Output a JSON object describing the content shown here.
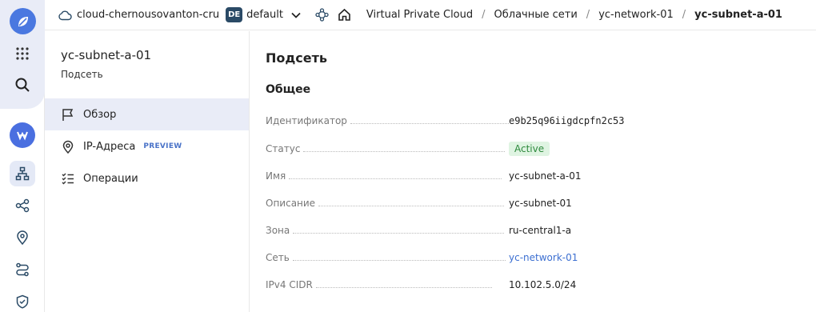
{
  "header": {
    "cloud_name": "cloud-chernousovanton-cru",
    "folder_badge": "DE",
    "folder_name": "default",
    "breadcrumbs": [
      "Virtual Private Cloud",
      "Облачные сети",
      "yc-network-01",
      "yc-subnet-a-01"
    ],
    "separator": "/"
  },
  "subnav": {
    "title": "yc-subnet-a-01",
    "subtitle": "Подсеть",
    "items": [
      {
        "label": "Обзор",
        "icon": "flag-icon",
        "active": true
      },
      {
        "label": "IP-Адреса",
        "icon": "location-pin-icon",
        "badge": "PREVIEW"
      },
      {
        "label": "Операции",
        "icon": "list-check-icon"
      }
    ]
  },
  "main": {
    "page_title": "Подсеть",
    "section_title": "Общее",
    "fields": [
      {
        "label": "Идентификатор",
        "value": "e9b25q96iigdcpfn2c53"
      },
      {
        "label": "Статус",
        "value": "Active"
      },
      {
        "label": "Имя",
        "value": "yc-subnet-a-01"
      },
      {
        "label": "Описание",
        "value": "yc-subnet-01"
      },
      {
        "label": "Зона",
        "value": "ru-central1-a"
      },
      {
        "label": "Сеть",
        "value": "yc-network-01"
      },
      {
        "label": "IPv4 CIDR",
        "value": "10.102.5.0/24"
      }
    ]
  },
  "colors": {
    "accent": "#4a78e0",
    "status_bg": "#dff4e2",
    "status_text": "#2f8a3e",
    "link": "#3c6fd1",
    "nav_active_bg": "#e9ecf7"
  }
}
